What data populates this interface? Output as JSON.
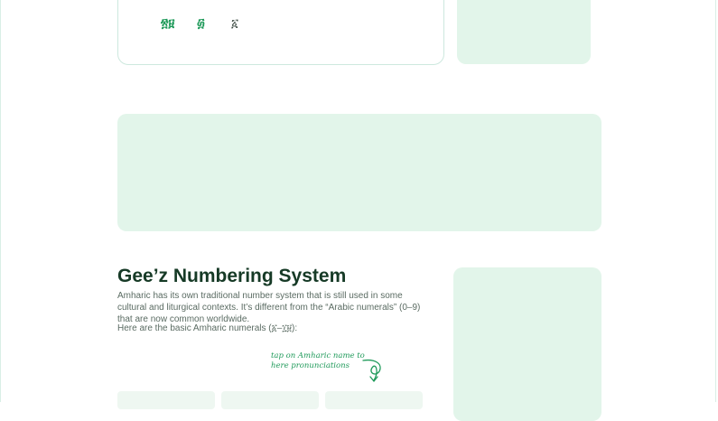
{
  "numerals_preview": {
    "items": [
      "፳፱",
      "፴",
      "፩"
    ]
  },
  "section": {
    "title": "Gee’z Numbering System",
    "description": "Amharic has its own traditional number system that is still used in some cultural and liturgical contexts. It’s different from the “Arabic numerals” (0–9) that are now common worldwide.",
    "note": "Here are the basic Amharic numerals (፩–፲፱):"
  },
  "hint": {
    "text": "tap on Amharic name to here pronunciations",
    "icon": "curly-arrow-icon"
  },
  "colors": {
    "accent": "#1f9a5a",
    "panel": "#e2f5ea",
    "heading": "#163a26"
  }
}
